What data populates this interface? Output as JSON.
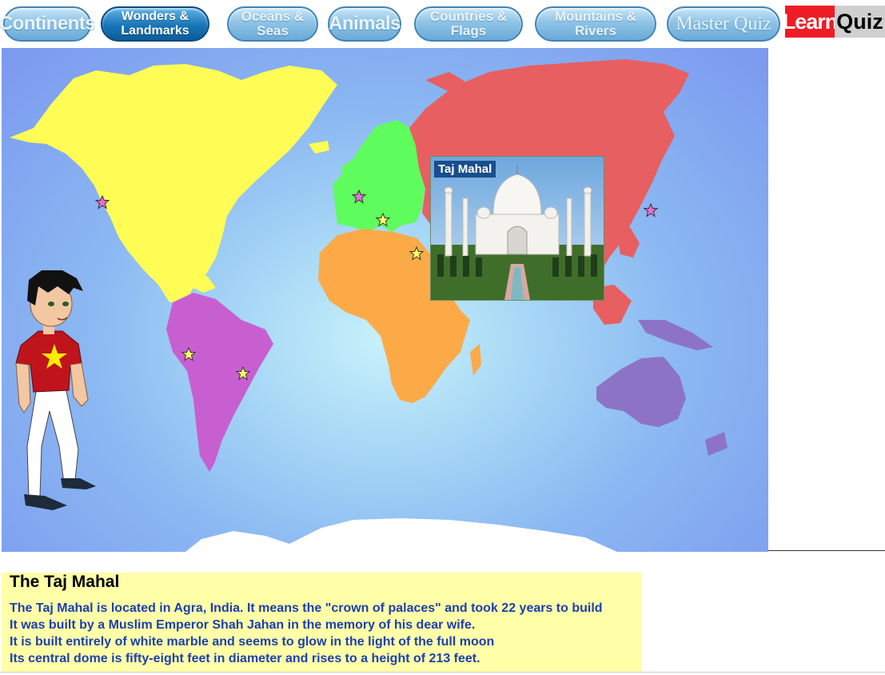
{
  "nav": {
    "tabs": [
      {
        "label": "Continents",
        "active": false
      },
      {
        "label": "Wonders & Landmarks",
        "active": true
      },
      {
        "label": "Oceans & Seas",
        "active": false
      },
      {
        "label": "Animals",
        "active": false
      },
      {
        "label": "Countries & Flags",
        "active": false
      },
      {
        "label": "Mountains & Rivers",
        "active": false
      },
      {
        "label": "Master Quiz",
        "active": false
      }
    ],
    "mode": {
      "learn": "Learn",
      "quiz": "Quiz"
    }
  },
  "popup": {
    "title": "Taj Mahal"
  },
  "info": {
    "title": "The Taj Mahal",
    "lines": [
      "The Taj Mahal is located in Agra, India. It means the \"crown of palaces\" and took 22 years to build",
      "It was built by a Muslim Emperor Shah Jahan in the memory of his dear wife.",
      "It is built entirely of white marble and seems to glow in the light of the full moon",
      "Its central dome is fifty-eight feet in diameter and rises to a height of 213 feet."
    ]
  },
  "colors": {
    "north_america": "#fffd55",
    "south_america": "#c85fd1",
    "europe": "#5efd5d",
    "africa": "#fcaa48",
    "asia": "#e75f60",
    "australia": "#8d73c6",
    "antarctica": "#ffffff",
    "star_pink": "#e86fd5",
    "star_yellow": "#ffff66"
  }
}
